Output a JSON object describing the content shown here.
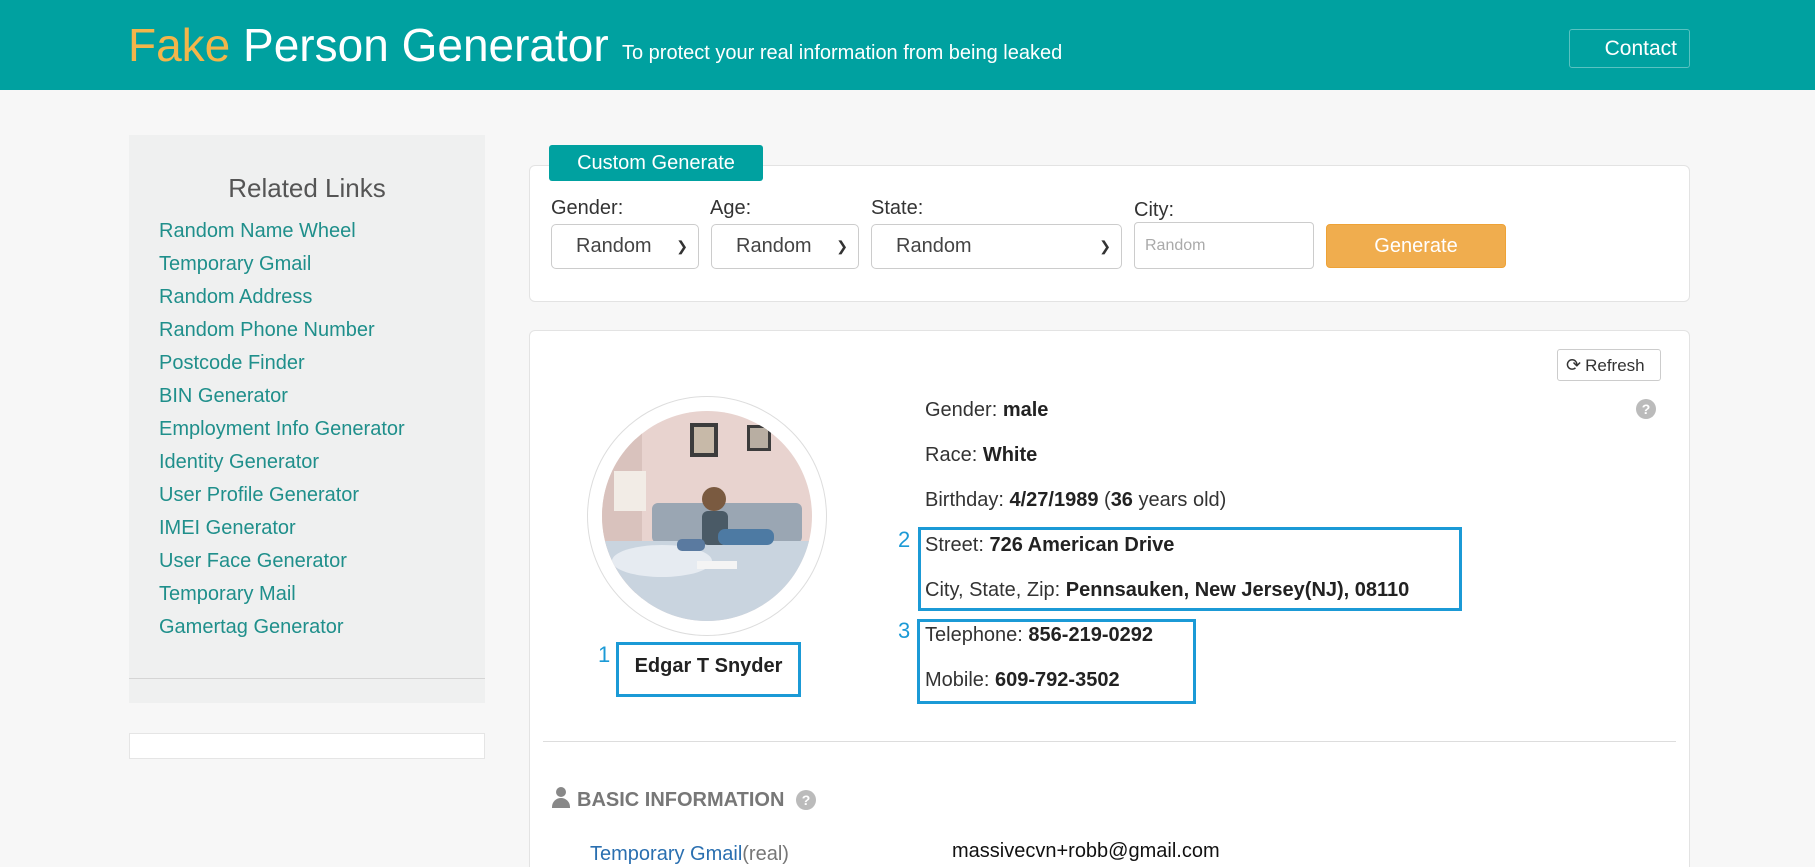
{
  "header": {
    "logo_fake": "Fake",
    "logo_rest": "Person Generator",
    "tagline": "To protect your real information from being leaked",
    "contact_label": "Contact",
    "bg_color": "#00a1a0"
  },
  "sidebar": {
    "title": "Related Links",
    "links": [
      "Random Name Wheel",
      "Temporary Gmail",
      "Random Address",
      "Random Phone Number",
      "Postcode Finder",
      "BIN Generator",
      "Employment Info Generator",
      "Identity Generator",
      "User Profile Generator",
      "IMEI Generator",
      "User Face Generator",
      "Temporary Mail",
      "Gamertag Generator"
    ]
  },
  "generator": {
    "tab_label": "Custom Generate",
    "gender_label": "Gender:",
    "gender_value": "Random",
    "age_label": "Age:",
    "age_value": "Random",
    "state_label": "State:",
    "state_value": "Random",
    "city_label": "City:",
    "city_placeholder": "Random",
    "generate_label": "Generate"
  },
  "result": {
    "refresh_label": "Refresh",
    "name": "Edgar T Snyder",
    "gender_label": "Gender: ",
    "gender": "male",
    "race_label": "Race: ",
    "race": "White",
    "birthday_label": "Birthday: ",
    "birthday": "4/27/1989",
    "age": "36",
    "age_suffix": " years old)",
    "street_label": "Street: ",
    "street": "726 American Drive",
    "city_label": "City, State, Zip: ",
    "city_state_zip": "Pennsauken, New Jersey(NJ), 08110",
    "telephone_label": "Telephone: ",
    "telephone": "856-219-0292",
    "mobile_label": "Mobile: ",
    "mobile": "609-792-3502"
  },
  "annotations": {
    "one": "1",
    "two": "2",
    "three": "3"
  },
  "basic_info": {
    "title": "BASIC INFORMATION",
    "row_label": "Temporary Gmail",
    "row_label_suffix": "(real)",
    "row_value": "massivecvn+robb@gmail.com"
  }
}
